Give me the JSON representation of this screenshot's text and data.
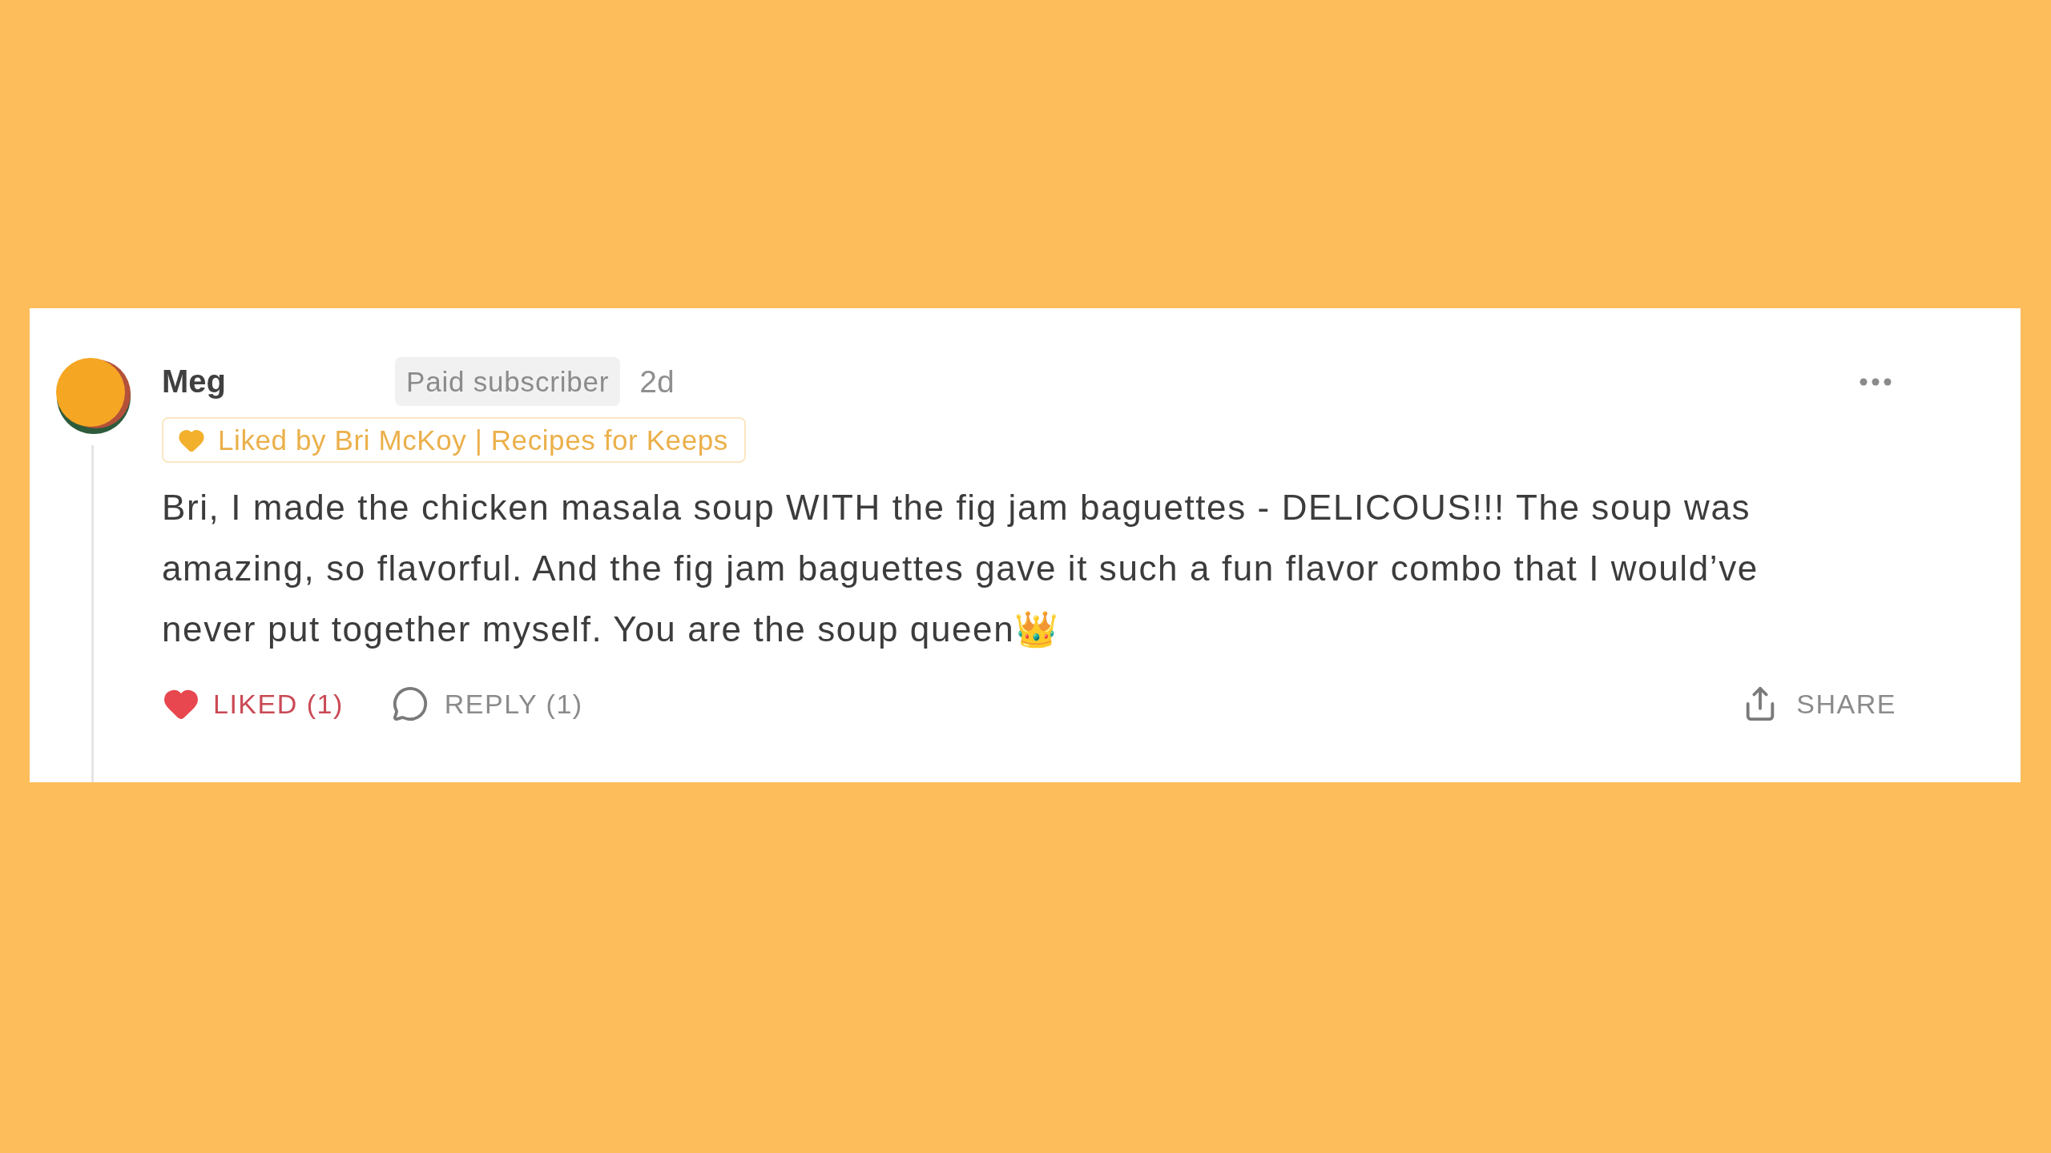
{
  "comment": {
    "author": "Meg",
    "badge": "Paid subscriber",
    "time": "2d",
    "liked_by": "Liked by Bri McKoy | Recipes for Keeps",
    "body": "Bri, I made the chicken masala soup WITH the fig jam baguettes - DELICOUS!!! The soup was amazing, so flavorful. And the fig jam baguettes gave it such a fun flavor combo that I would’ve never put together myself. You are the soup queen👑"
  },
  "actions": {
    "like": {
      "label": "LIKED (1)",
      "liked": true
    },
    "reply": {
      "label": "REPLY (1)"
    },
    "share": {
      "label": "SHARE"
    }
  }
}
